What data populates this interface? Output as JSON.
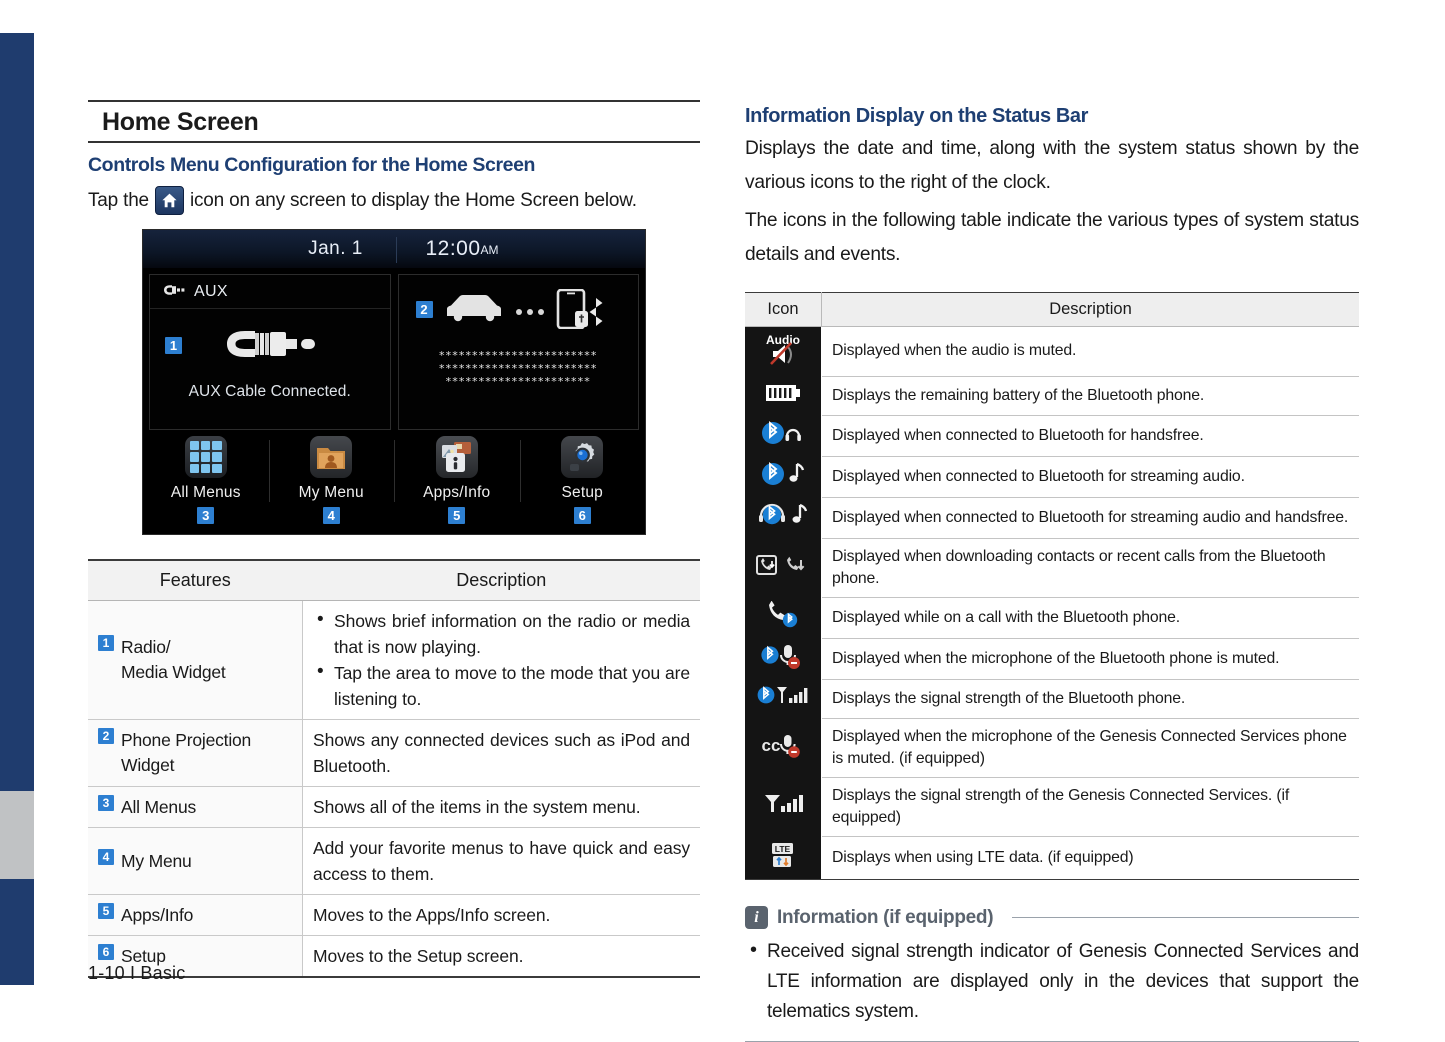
{
  "document": {
    "footer": "1-10 I Basic"
  },
  "left": {
    "section_title": "Home Screen",
    "subsection_title": "Controls Menu Configuration for the Home Screen",
    "intro_prefix": "Tap the",
    "intro_suffix": "icon on any screen to display the Home Screen below.",
    "home_icon_name": "home-icon",
    "headunit": {
      "date": "Jan.  1",
      "time": "12:00",
      "ampm": "AM",
      "aux_widget": {
        "badge": "1",
        "title": "AUX",
        "caption": "AUX Cable Connected."
      },
      "projection_widget": {
        "badge": "2",
        "masked_line1": "************************",
        "masked_line2": "************************",
        "masked_line3": "**********************"
      },
      "launcher": [
        {
          "badge": "3",
          "label": "All Menus",
          "icon": "grid-apps-icon"
        },
        {
          "badge": "4",
          "label": "My Menu",
          "icon": "folder-person-icon"
        },
        {
          "badge": "5",
          "label": "Apps/Info",
          "icon": "apps-info-icon"
        },
        {
          "badge": "6",
          "label": "Setup",
          "icon": "gear-icon"
        }
      ]
    },
    "features_table": {
      "headers": [
        "Features",
        "Description"
      ],
      "rows": [
        {
          "badge": "1",
          "feature_line1": "Radio/",
          "feature_line2": "Media Widget",
          "bullets": [
            "Shows brief information on the radio or media that is now playing.",
            "Tap the area to move to the mode that you are listening to."
          ]
        },
        {
          "badge": "2",
          "feature_line1": "Phone Projection",
          "feature_line2": "Widget",
          "description": "Shows any connected devices such as iPod and Bluetooth."
        },
        {
          "badge": "3",
          "feature_line1": "All Menus",
          "feature_line2": "",
          "description": "Shows all of the items in the system menu."
        },
        {
          "badge": "4",
          "feature_line1": "My Menu",
          "feature_line2": "",
          "description": "Add your favorite menus to have quick and easy access to them."
        },
        {
          "badge": "5",
          "feature_line1": "Apps/Info",
          "feature_line2": "",
          "description": "Moves to the Apps/Info screen."
        },
        {
          "badge": "6",
          "feature_line1": "Setup",
          "feature_line2": "",
          "description": "Moves to the Setup screen."
        }
      ]
    }
  },
  "right": {
    "section_title": "Information Display on the Status Bar",
    "paragraph1": "Displays the date and time, along with the system status shown by the various icons to the right of the clock.",
    "paragraph2": "The icons in the following table indicate the various types of system status details and events.",
    "status_table": {
      "headers": [
        "Icon",
        "Description"
      ],
      "rows": [
        {
          "icon": "audio-mute-icon",
          "description": "Displayed when the audio is muted."
        },
        {
          "icon": "battery-level-icon",
          "description": "Displays the remaining battery of the Bluetooth phone."
        },
        {
          "icon": "bluetooth-handsfree-icon",
          "description": "Displayed when connected to Bluetooth for handsfree."
        },
        {
          "icon": "bluetooth-audio-icon",
          "description": "Displayed when connected to Bluetooth for streaming audio."
        },
        {
          "icon": "bluetooth-audio-handsfree-icon",
          "description": "Displayed when connected to Bluetooth for streaming audio and handsfree."
        },
        {
          "icon": "contacts-download-icon",
          "description": "Displayed when downloading contacts or recent calls from the Bluetooth phone."
        },
        {
          "icon": "bluetooth-call-active-icon",
          "description": "Displayed while on a call with the Bluetooth phone."
        },
        {
          "icon": "bluetooth-mic-muted-icon",
          "description": "Displayed when the microphone of the Bluetooth phone is muted."
        },
        {
          "icon": "bluetooth-signal-strength-icon",
          "description": "Displays the signal strength of the Bluetooth phone."
        },
        {
          "icon": "gcs-mic-muted-icon",
          "description": "Displayed when the microphone of the Genesis Connected Services phone is muted. (if equipped)"
        },
        {
          "icon": "gcs-signal-strength-icon",
          "description": "Displays the signal strength of the Genesis Connected Services.\n(if equipped)"
        },
        {
          "icon": "lte-data-icon",
          "description": "Displays when using LTE data. (if equipped)"
        }
      ]
    },
    "information_box": {
      "badge": "i",
      "title": "Information (if equipped)",
      "bullets": [
        "Received signal strength indicator of Genesis Connected Services and LTE information are displayed only in the devices that support the telematics system."
      ]
    }
  },
  "colors": {
    "heading_blue": "#1e3f73",
    "badge_blue": "#2d7fd1",
    "sidebar_blue": "#1f3c6e",
    "sidebar_tab_gray": "#c0c2c4",
    "info_gray": "#5a636e"
  }
}
